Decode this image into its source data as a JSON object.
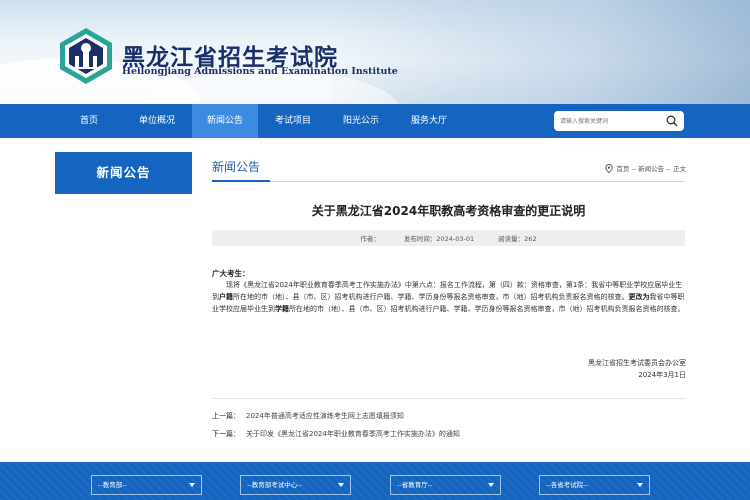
{
  "header": {
    "site_name_cn": "黑龙江省招生考试院",
    "site_name_en": "Heilongjiang Admissions and Examination Institute",
    "brand_color": "#1565c0"
  },
  "nav": {
    "items": [
      {
        "label": "首页",
        "active": false
      },
      {
        "label": "单位概况",
        "active": false
      },
      {
        "label": "新闻公告",
        "active": true
      },
      {
        "label": "考试项目",
        "active": false
      },
      {
        "label": "阳光公示",
        "active": false
      },
      {
        "label": "服务大厅",
        "active": false
      }
    ],
    "search_placeholder": "请输入搜索关键词"
  },
  "sidebar": {
    "title": "新闻公告"
  },
  "section": {
    "title": "新闻公告",
    "breadcrumb": "首页 -- 新闻公告 -- 正文"
  },
  "article": {
    "title": "关于黑龙江省2024年职教高考资格审查的更正说明",
    "author_label": "作者：",
    "date_label": "发布时间：",
    "date": "2024-03-01",
    "views_label": "阅读量：",
    "views": "262",
    "greeting": "广大考生：",
    "body_1": "现将《黑龙江省2024年职业教育春季高考工作实施办法》中第六点：报名工作流程，第（四）款：资格审查，第1条：我省中等职业学校应届毕业生到",
    "body_b1": "户籍",
    "body_2": "所在地的市（地）、县（市、区）招考机构进行户籍、学籍、学历身份等报名资格审查，市（地）招考机构负责报名资格的核查。",
    "body_b2": "更改为",
    "body_3": "我省中等职业学校应届毕业生到",
    "body_b3": "学籍",
    "body_4": "所在地的市（地）、县（市、区）招考机构进行户籍、学籍、学历身份等报名资格审查，市（地）招考机构负责报名资格的核查。",
    "signature_org": "黑龙江省招生考试委员会办公室",
    "signature_date": "2024年3月1日"
  },
  "pager": {
    "prev_label": "上一篇：",
    "prev_title": "2024年普通高考适应性演练考生网上志愿填报须知",
    "next_label": "下一篇：",
    "next_title": "关于印发《黑龙江省2024年职业教育春季高考工作实施办法》的通知"
  },
  "footer": {
    "links": [
      {
        "label": "--教育部--"
      },
      {
        "label": "--教育部考试中心--"
      },
      {
        "label": "--省教育厅--"
      },
      {
        "label": "--各省考试院--"
      }
    ]
  }
}
